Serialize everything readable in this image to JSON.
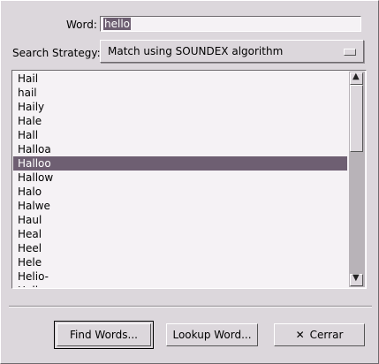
{
  "form": {
    "word_label": "Word:",
    "word_value": "hello",
    "strategy_label": "Search Strategy:",
    "strategy_value": "Match using SOUNDEX algorithm"
  },
  "results": {
    "items": [
      "Hail",
      "hail",
      "Haily",
      "Hale",
      "Hall",
      "Halloa",
      "Halloo",
      "Hallow",
      "Halo",
      "Halwe",
      "Haul",
      "Heal",
      "Heel",
      "Hele",
      "Helio-",
      "Hell"
    ],
    "selected": "Halloo"
  },
  "buttons": {
    "find": "Find Words...",
    "lookup": "Lookup Word...",
    "close": "Cerrar",
    "close_icon": "x-icon"
  },
  "colors": {
    "selection": "#6e5f72",
    "background": "#dcd7dc"
  }
}
